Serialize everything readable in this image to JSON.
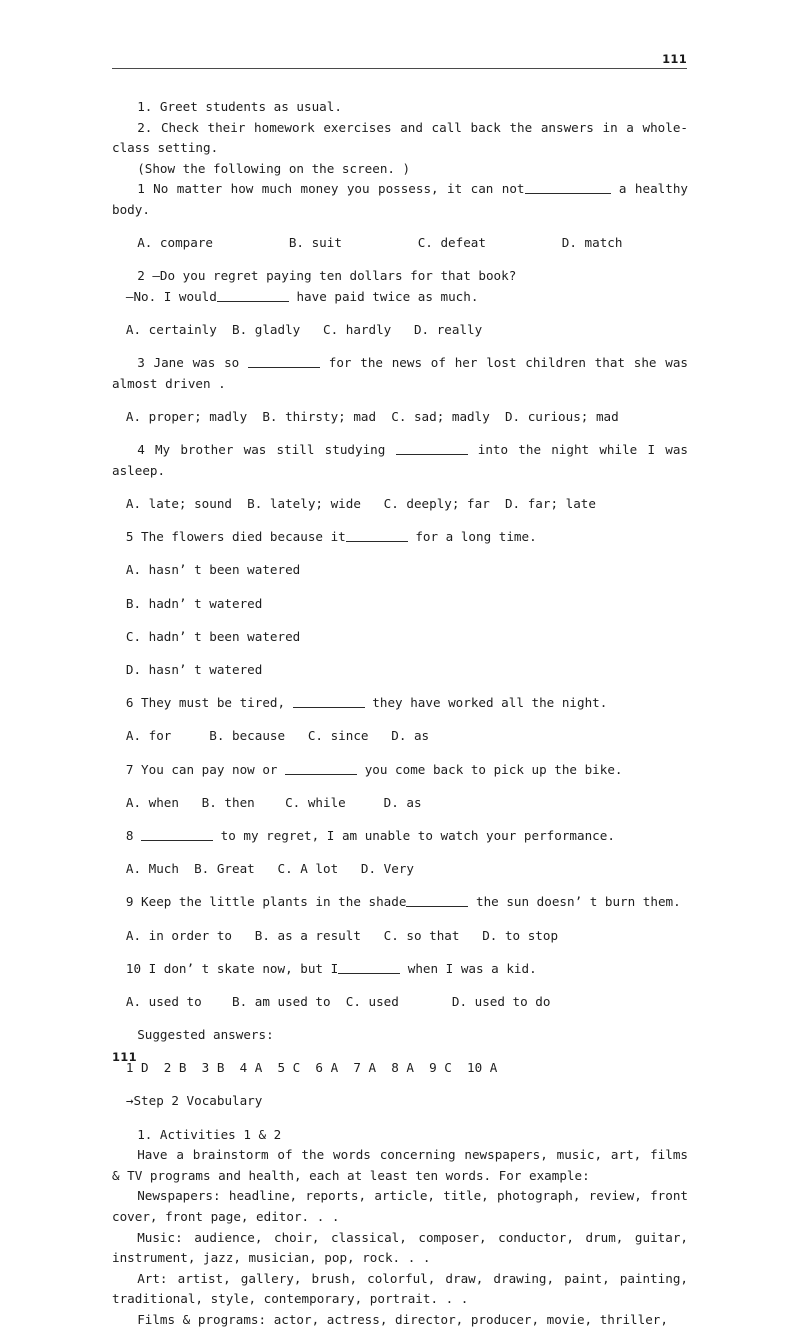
{
  "header": {
    "folio": "111"
  },
  "footer": {
    "folio": "111"
  },
  "procedure": {
    "step1_item1": "1. Greet students as usual.",
    "step1_item2": "2. Check their homework exercises and call back the answers in a whole-class setting.",
    "screen_note": "(Show the following on the screen. )"
  },
  "questions": [
    {
      "stem_before": "1 No matter how much money you possess, it can not",
      "stem_after": "a healthy body.",
      "options": "A. compare          B. suit          C. defeat          D. match"
    },
    {
      "stem_line1": "2 —Do you regret paying ten dollars for that book?",
      "stem_line2_before": "—No. I would",
      "stem_line2_after": "have paid twice as much.",
      "options": "A. certainly  B. gladly   C. hardly   D. really"
    },
    {
      "stem_before": "3 Jane was so",
      "stem_after": "for the news of her lost children that she was almost driven .",
      "options": "A. proper; madly  B. thirsty; mad  C. sad; madly  D. curious; mad"
    },
    {
      "stem_before": "4 My brother was still studying",
      "stem_after": "into the night while I was asleep.",
      "options": "A. late; sound  B. lately; wide   C. deeply; far  D. far; late"
    },
    {
      "stem_before": "5 The flowers died because it",
      "stem_after": "for a long time.",
      "options_stacked": [
        "A. hasn’ t been watered",
        "B. hadn’ t watered",
        "C. hadn’ t been watered",
        "D. hasn’ t watered"
      ]
    },
    {
      "stem_before": "6 They must be tired,",
      "stem_after": "they have worked all the night.",
      "options": "A. for     B. because   C. since   D. as"
    },
    {
      "stem_before": "7 You can pay now or",
      "stem_after": "you come back to pick up the bike.",
      "options": "A. when   B. then    C. while     D. as"
    },
    {
      "stem_before": "8",
      "stem_after": "to my regret, I am unable to watch your performance.",
      "options": "A. Much  B. Great   C. A lot   D. Very"
    },
    {
      "stem_before": "9 Keep the little plants in the shade",
      "stem_after": "the sun doesn’ t burn them.",
      "options": "A. in order to   B. as a result   C. so that   D. to stop"
    },
    {
      "stem_before": "10 I don’ t skate now, but I",
      "stem_after": "when I was a kid.",
      "options": "A. used to    B. am used to  C. used       D. used to do"
    }
  ],
  "answers": {
    "label": "Suggested answers:",
    "line": "1 D  2 B  3 B  4 A  5 C  6 A  7 A  8 A  9 C  10 A"
  },
  "step2": {
    "arrow_glyph": "→",
    "heading": "Step 2 Vocabulary",
    "activities_label": "1. Activities 1 & 2",
    "instruction": "Have a brainstorm of the words concerning newspapers, music, art, films & TV programs and health, each at least ten words. For example:",
    "categories": [
      {
        "name": "Newspapers:",
        "words": "headline, reports, article, title, photograph, review, front cover, front page, editor. . ."
      },
      {
        "name": "Music:",
        "words": "audience, choir, classical, composer, conductor, drum, guitar, instrument, jazz, musician, pop, rock. . ."
      },
      {
        "name": "Art:",
        "words": "artist, gallery, brush, colorful, draw, drawing, paint, painting, traditional, style, contemporary, portrait. . ."
      },
      {
        "name": "Films & programs:",
        "words": "actor, actress, director, producer, movie, thriller,"
      }
    ]
  }
}
